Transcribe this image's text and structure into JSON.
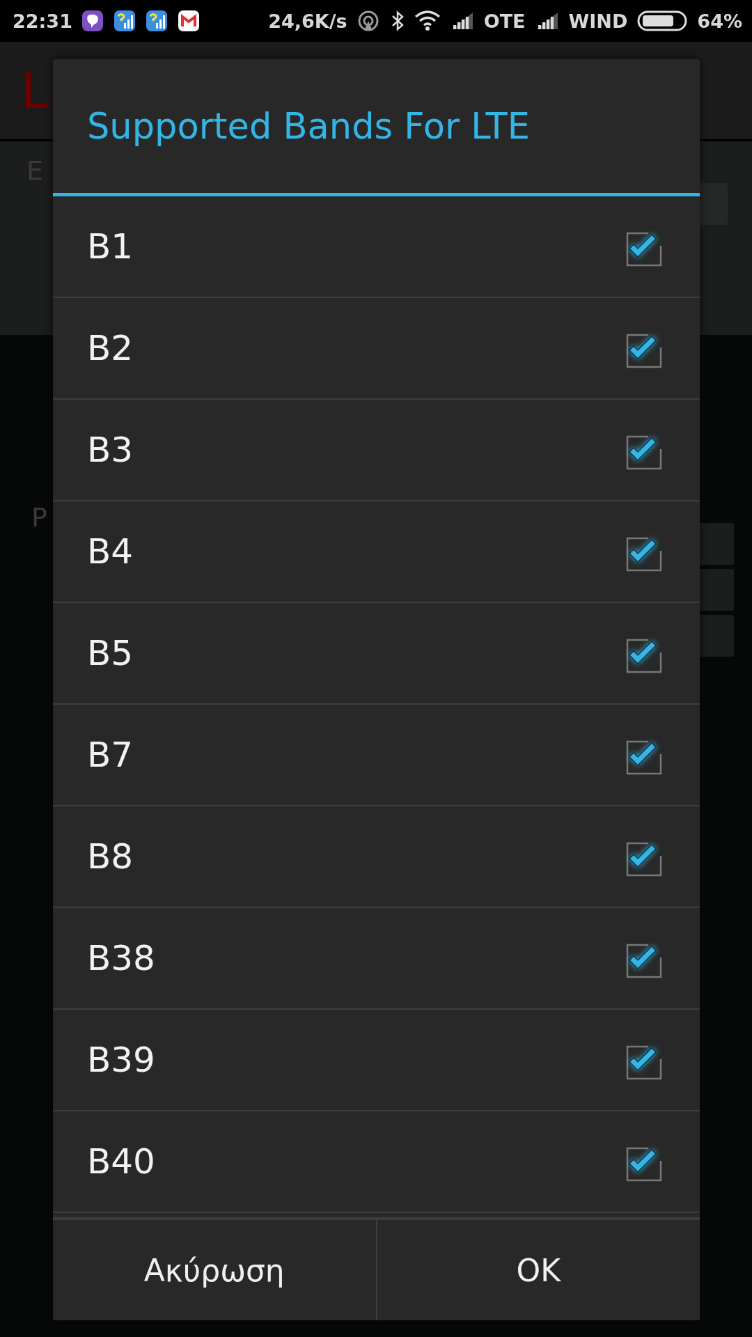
{
  "status_bar": {
    "time": "22:31",
    "speed": "24,6K/s",
    "carriers": [
      "OTE",
      "WIND"
    ],
    "battery": "64%"
  },
  "background": {
    "title": "L",
    "labels": [
      "E",
      "P"
    ]
  },
  "dialog": {
    "title": "Supported Bands For LTE",
    "bands": [
      {
        "label": "B1",
        "checked": true
      },
      {
        "label": "B2",
        "checked": true
      },
      {
        "label": "B3",
        "checked": true
      },
      {
        "label": "B4",
        "checked": true
      },
      {
        "label": "B5",
        "checked": true
      },
      {
        "label": "B7",
        "checked": true
      },
      {
        "label": "B8",
        "checked": true
      },
      {
        "label": "B38",
        "checked": true
      },
      {
        "label": "B39",
        "checked": true
      },
      {
        "label": "B40",
        "checked": true
      }
    ],
    "buttons": [
      "Ακύρωση",
      "OK"
    ]
  }
}
